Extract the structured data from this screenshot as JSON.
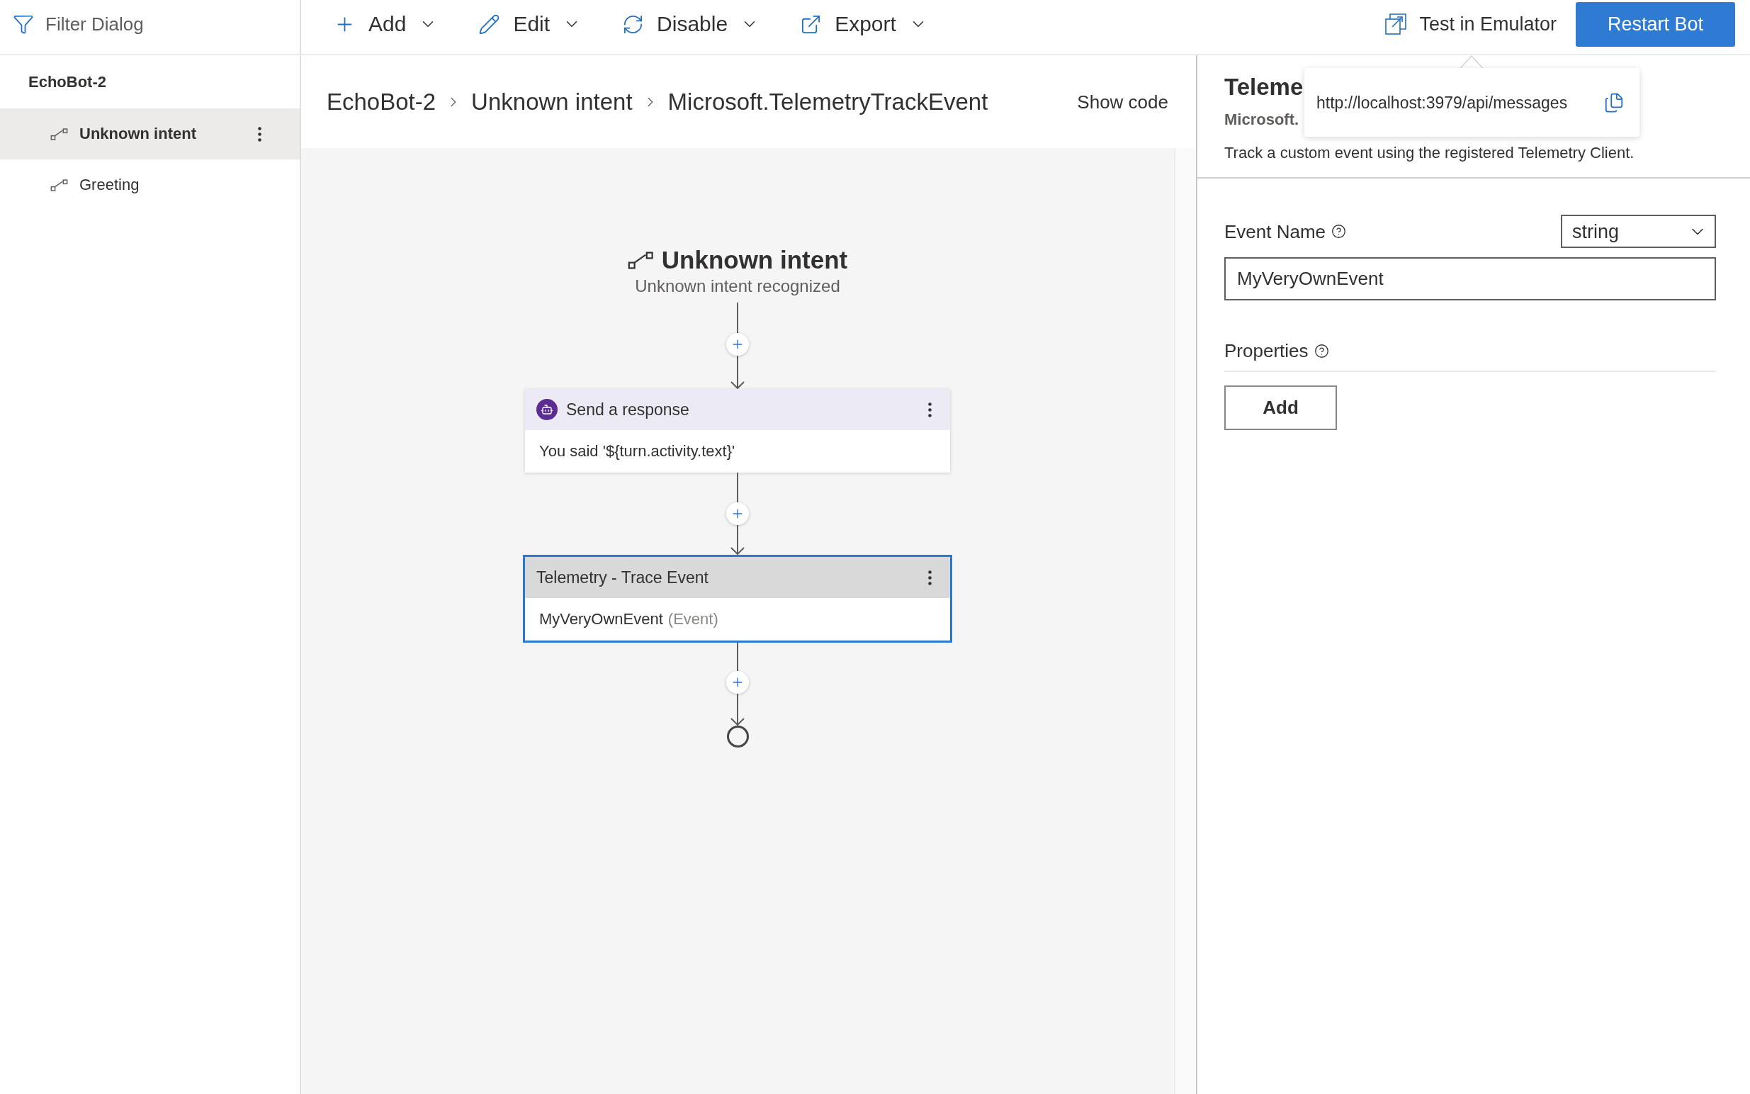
{
  "sidebar": {
    "filter": {
      "placeholder": "Filter Dialog"
    },
    "bot": "EchoBot-2",
    "items": [
      {
        "label": "Unknown intent",
        "selected": true
      },
      {
        "label": "Greeting",
        "selected": false
      }
    ]
  },
  "toolbar": {
    "menus": [
      {
        "kind": "add",
        "label": "Add"
      },
      {
        "kind": "edit",
        "label": "Edit"
      },
      {
        "kind": "disable",
        "label": "Disable"
      },
      {
        "kind": "export",
        "label": "Export"
      }
    ],
    "test_button": "Test in Emulator",
    "restart_button": "Restart Bot"
  },
  "breadcrumb": {
    "items": [
      "EchoBot-2",
      "Unknown intent",
      "Microsoft.TelemetryTrackEvent"
    ],
    "show_code": "Show code"
  },
  "canvas": {
    "trigger": {
      "title": "Unknown intent",
      "subtitle": "Unknown intent recognized"
    },
    "nodes": [
      {
        "kind": "response",
        "title": "Send a response",
        "body": "You said '${turn.activity.text}'",
        "selected": false
      },
      {
        "kind": "telemetry",
        "title": "Telemetry - Trace Event",
        "body": "MyVeryOwnEvent",
        "body_note": "(Event)",
        "selected": true
      }
    ]
  },
  "popover": {
    "url": "http://localhost:3979/api/messages"
  },
  "properties_panel": {
    "title": "Teleme",
    "subtitle": "Microsoft.",
    "description": "Track a custom event using the registered Telemetry Client.",
    "fields": [
      {
        "kind": "text",
        "label": "Event Name",
        "type": "string",
        "value": "MyVeryOwnEvent"
      },
      {
        "kind": "list",
        "label": "Properties",
        "button": "Add"
      }
    ]
  }
}
